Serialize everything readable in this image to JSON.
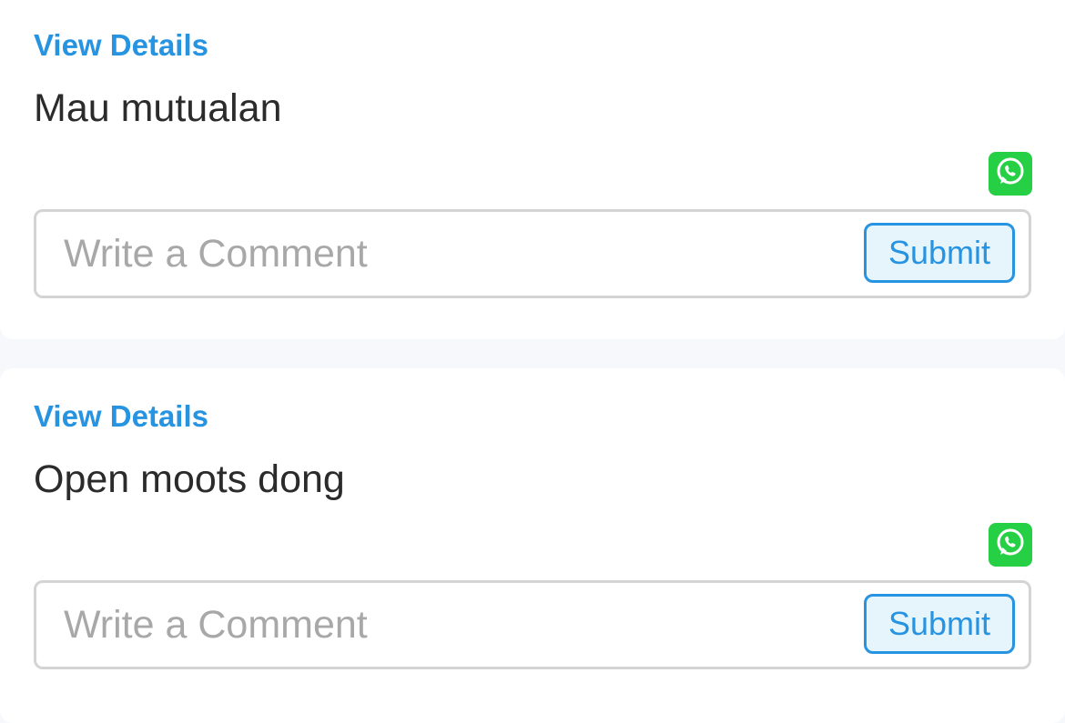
{
  "posts": [
    {
      "view_details_label": "View Details",
      "text": "Mau mutualan",
      "share_icon": "whatsapp-icon",
      "comment_placeholder": "Write a Comment",
      "comment_value": "",
      "submit_label": "Submit"
    },
    {
      "view_details_label": "View Details",
      "text": "Open moots dong",
      "share_icon": "whatsapp-icon",
      "comment_placeholder": "Write a Comment",
      "comment_value": "",
      "submit_label": "Submit"
    }
  ],
  "colors": {
    "accent": "#2694e0",
    "whatsapp": "#25d045",
    "text": "#2b2b2b",
    "placeholder": "#a8a8a8"
  }
}
